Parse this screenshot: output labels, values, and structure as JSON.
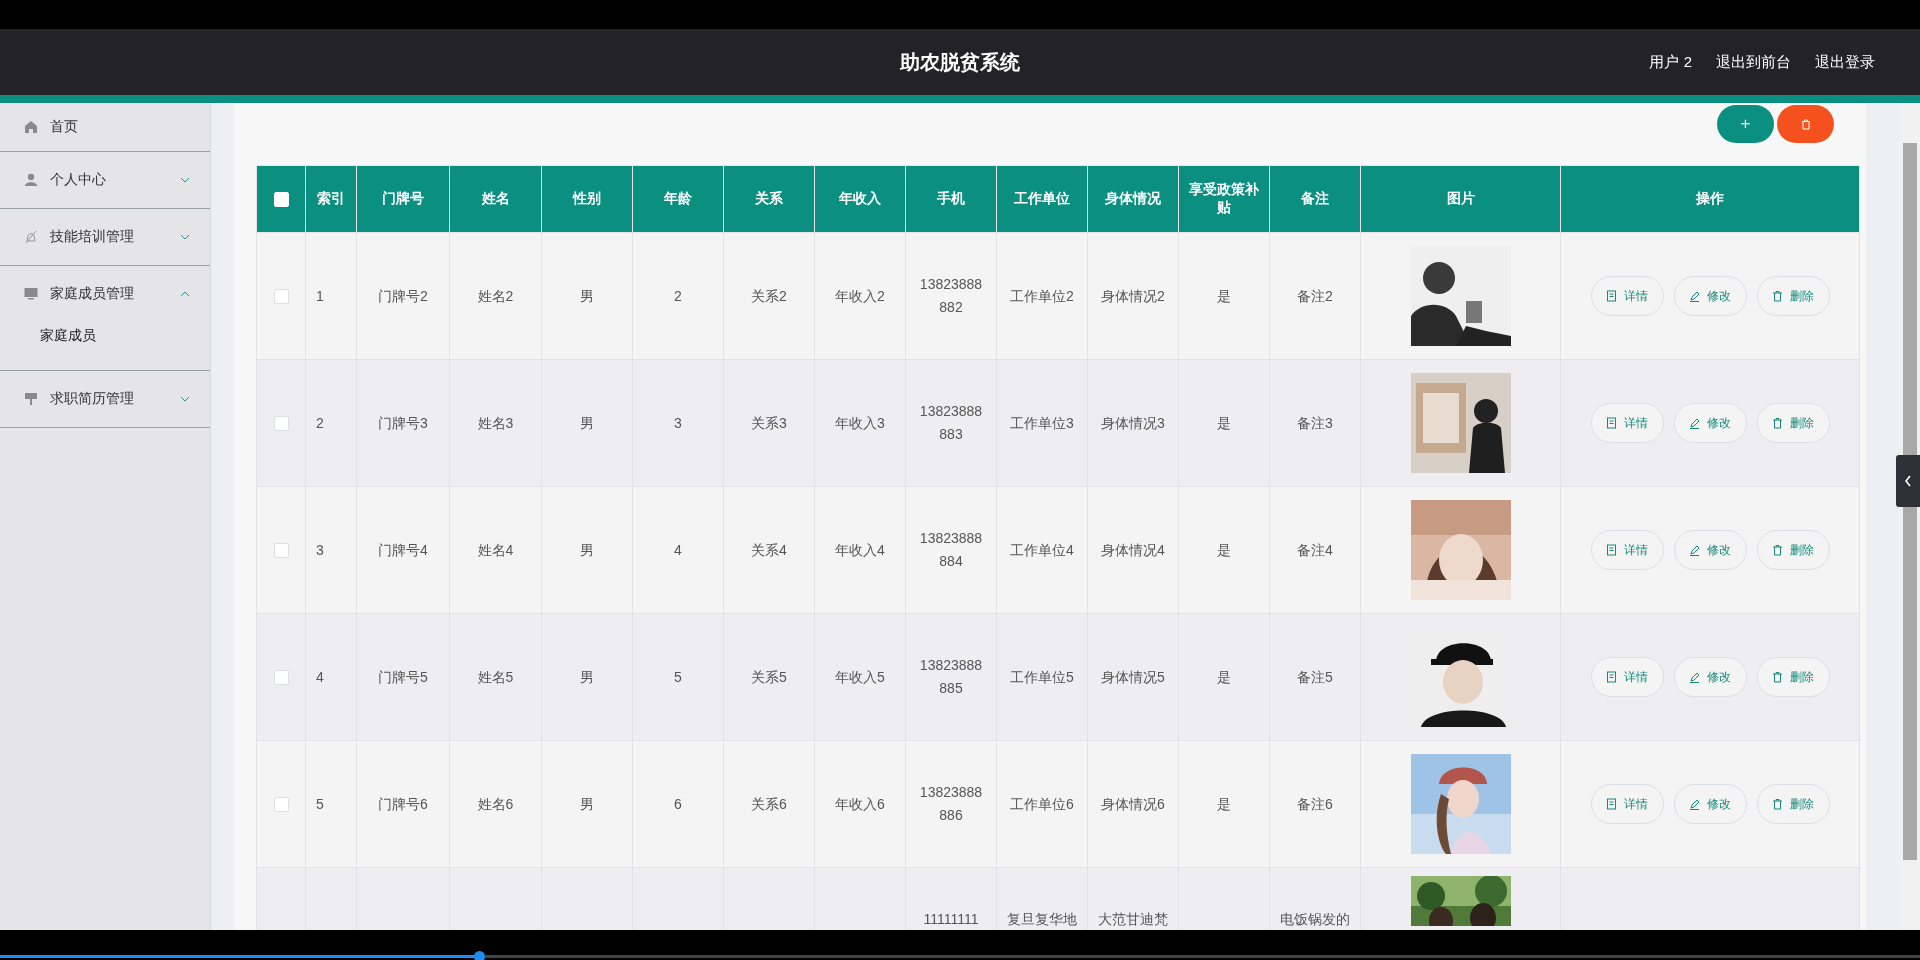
{
  "header": {
    "title": "助农脱贫系统",
    "links": [
      "用户 2",
      "退出到前台",
      "退出登录"
    ]
  },
  "sidebar": {
    "items": [
      {
        "label": "首页",
        "kind": "link"
      },
      {
        "label": "个人中心",
        "kind": "group",
        "expanded": false
      },
      {
        "label": "技能培训管理",
        "kind": "group",
        "expanded": false
      },
      {
        "label": "家庭成员管理",
        "kind": "group",
        "expanded": true,
        "children": [
          {
            "label": "家庭成员"
          }
        ]
      },
      {
        "label": "求职简历管理",
        "kind": "group",
        "expanded": false
      }
    ]
  },
  "toolbar": {
    "buttons": [
      {
        "kind": "add",
        "label": "+"
      },
      {
        "kind": "delete"
      }
    ]
  },
  "table": {
    "select_all": {
      "checked": false
    },
    "columns": [
      "索引",
      "门牌号",
      "姓名",
      "性别",
      "年龄",
      "关系",
      "年收入",
      "手机",
      "工作单位",
      "身体情况",
      "享受政策补贴",
      "备注",
      "图片",
      "操作"
    ],
    "rows": [
      {
        "checked": false,
        "cells": [
          "1",
          "门牌号2",
          "姓名2",
          "男",
          "2",
          "关系2",
          "年收入2",
          "13823888882",
          "工作单位2",
          "身体情况2",
          "是",
          "备注2"
        ],
        "actions": [
          "详情",
          "修改",
          "删除"
        ]
      },
      {
        "checked": false,
        "cells": [
          "2",
          "门牌号3",
          "姓名3",
          "男",
          "3",
          "关系3",
          "年收入3",
          "13823888883",
          "工作单位3",
          "身体情况3",
          "是",
          "备注3"
        ],
        "actions": [
          "详情",
          "修改",
          "删除"
        ]
      },
      {
        "checked": false,
        "cells": [
          "3",
          "门牌号4",
          "姓名4",
          "男",
          "4",
          "关系4",
          "年收入4",
          "13823888884",
          "工作单位4",
          "身体情况4",
          "是",
          "备注4"
        ],
        "actions": [
          "详情",
          "修改",
          "删除"
        ]
      },
      {
        "checked": false,
        "cells": [
          "4",
          "门牌号5",
          "姓名5",
          "男",
          "5",
          "关系5",
          "年收入5",
          "13823888885",
          "工作单位5",
          "身体情况5",
          "是",
          "备注5"
        ],
        "actions": [
          "详情",
          "修改",
          "删除"
        ]
      },
      {
        "checked": false,
        "cells": [
          "5",
          "门牌号6",
          "姓名6",
          "男",
          "6",
          "关系6",
          "年收入6",
          "13823888886",
          "工作单位6",
          "身体情况6",
          "是",
          "备注6"
        ],
        "actions": [
          "详情",
          "修改",
          "删除"
        ]
      },
      {
        "cells": [
          null,
          null,
          null,
          null,
          null,
          null,
          null,
          "11111111",
          "复旦复华地",
          "大范甘迪梵",
          null,
          "电饭锅发的"
        ]
      }
    ]
  },
  "player": {
    "progress": {
      "level": 0.25
    }
  }
}
